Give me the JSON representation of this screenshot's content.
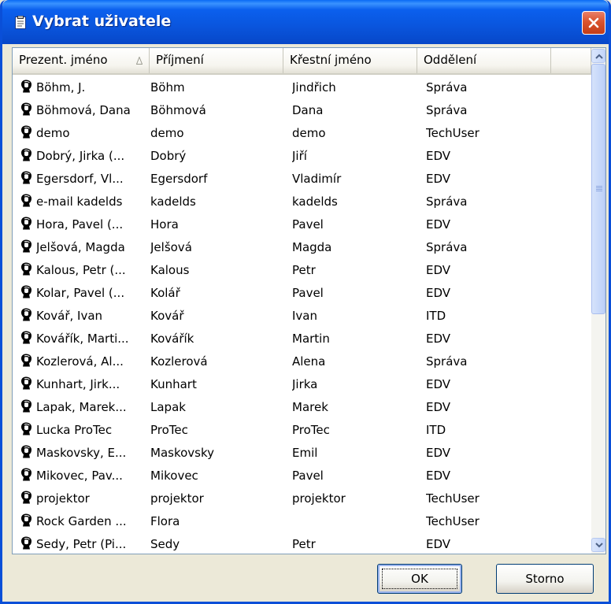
{
  "window": {
    "title": "Vybrat uživatele"
  },
  "columns": [
    "Prezent. jméno",
    "Příjmení",
    "Křestní jméno",
    "Oddělení"
  ],
  "rows": [
    [
      "Böhm, J.",
      "Böhm",
      "Jindřich",
      "Správa"
    ],
    [
      "Böhmová, Dana",
      "Böhmová",
      "Dana",
      "Správa"
    ],
    [
      "demo",
      "demo",
      "demo",
      "TechUser"
    ],
    [
      "Dobrý, Jirka (...",
      "Dobrý",
      "Jiří",
      "EDV"
    ],
    [
      "Egersdorf, Vl...",
      "Egersdorf",
      "Vladimír",
      "EDV"
    ],
    [
      "e-mail kadelds",
      "kadelds",
      "kadelds",
      "Správa"
    ],
    [
      "Hora, Pavel (...",
      "Hora",
      "Pavel",
      "EDV"
    ],
    [
      "Jelšová, Magda",
      "Jelšová",
      "Magda",
      "Správa"
    ],
    [
      "Kalous, Petr (...",
      "Kalous",
      "Petr",
      "EDV"
    ],
    [
      "Kolar, Pavel (...",
      "Kolář",
      "Pavel",
      "EDV"
    ],
    [
      "Kovář, Ivan",
      "Kovář",
      "Ivan",
      "ITD"
    ],
    [
      "Kovářík, Marti...",
      "Kovářík",
      "Martin",
      "EDV"
    ],
    [
      "Kozlerová, Al...",
      "Kozlerová",
      "Alena",
      "Správa"
    ],
    [
      "Kunhart, Jirk...",
      "Kunhart",
      "Jirka",
      "EDV"
    ],
    [
      "Lapak, Marek...",
      "Lapak",
      "Marek",
      "EDV"
    ],
    [
      "Lucka ProTec",
      "ProTec",
      "ProTec",
      "ITD"
    ],
    [
      "Maskovsky, E...",
      "Maskovsky",
      "Emil",
      "EDV"
    ],
    [
      "Mikovec, Pav...",
      "Mikovec",
      "Pavel",
      "EDV"
    ],
    [
      "projektor",
      "projektor",
      "projektor",
      "TechUser"
    ],
    [
      "Rock Garden ...",
      "Flora",
      "",
      "TechUser"
    ],
    [
      "Sedy, Petr (Pi...",
      "Sedy",
      "Petr",
      "EDV"
    ]
  ],
  "buttons": {
    "ok": "OK",
    "cancel": "Storno"
  },
  "colors": {
    "titlebar": "#0a55dd",
    "close": "#d9532e",
    "face": "#ece9d8"
  }
}
